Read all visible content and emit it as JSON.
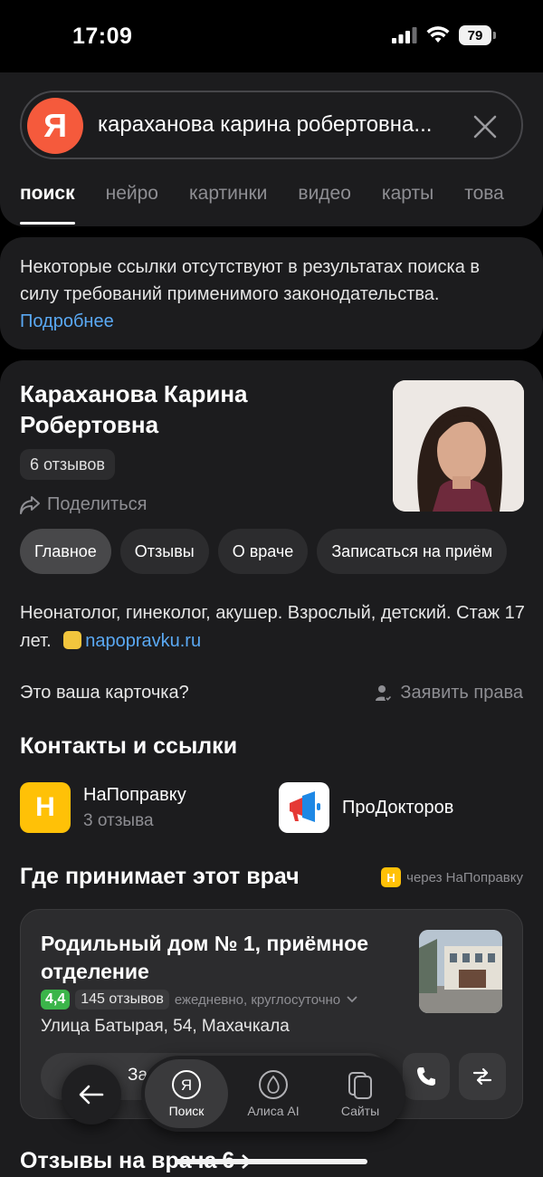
{
  "status_bar": {
    "time": "17:09",
    "battery": "79"
  },
  "search": {
    "query": "караханова карина робертовна...",
    "logo": "Я"
  },
  "tabs": [
    "поиск",
    "нейро",
    "картинки",
    "видео",
    "карты",
    "това"
  ],
  "notice": {
    "text": "Некоторые ссылки отсутствуют в результатах поиска в силу требований применимого законодательства.",
    "link": "Подробнее"
  },
  "doctor": {
    "name": "Караханова Карина Робертовна",
    "reviews": "6 отзывов",
    "share": "Поделиться",
    "chips": [
      "Главное",
      "Отзывы",
      "О враче",
      "Записаться на приём"
    ],
    "description": "Неонатолог, гинеколог, акушер. Взрослый, детский. Стаж 17 лет.",
    "source": "napopravku.ru",
    "claim_question": "Это ваша карточка?",
    "claim_action": "Заявить права"
  },
  "contacts": {
    "title": "Контакты и ссылки",
    "items": [
      {
        "name": "НаПоправку",
        "sub": "3 отзыва",
        "logo_letter": "Н",
        "color": "#ffc107"
      },
      {
        "name": "ПроДокторов",
        "sub": "",
        "color": "#ffffff"
      }
    ]
  },
  "locations": {
    "title": "Где принимает этот врач",
    "via": "через НаПоправку",
    "via_badge": "Н",
    "clinic": {
      "name": "Родильный дом № 1, приёмное отделение",
      "rating": "4,4",
      "reviews": "145 отзывов",
      "hours": "ежедневно, круглосуточно",
      "address": "Улица Батырая, 54, Махачкала",
      "book_label": "За"
    }
  },
  "reviews_section": {
    "title": "Отзывы на врача",
    "count": "6"
  },
  "bottom_nav": {
    "items": [
      {
        "label": "Поиск",
        "active": true
      },
      {
        "label": "Алиса AI",
        "active": false
      },
      {
        "label": "Сайты",
        "active": false
      }
    ]
  }
}
